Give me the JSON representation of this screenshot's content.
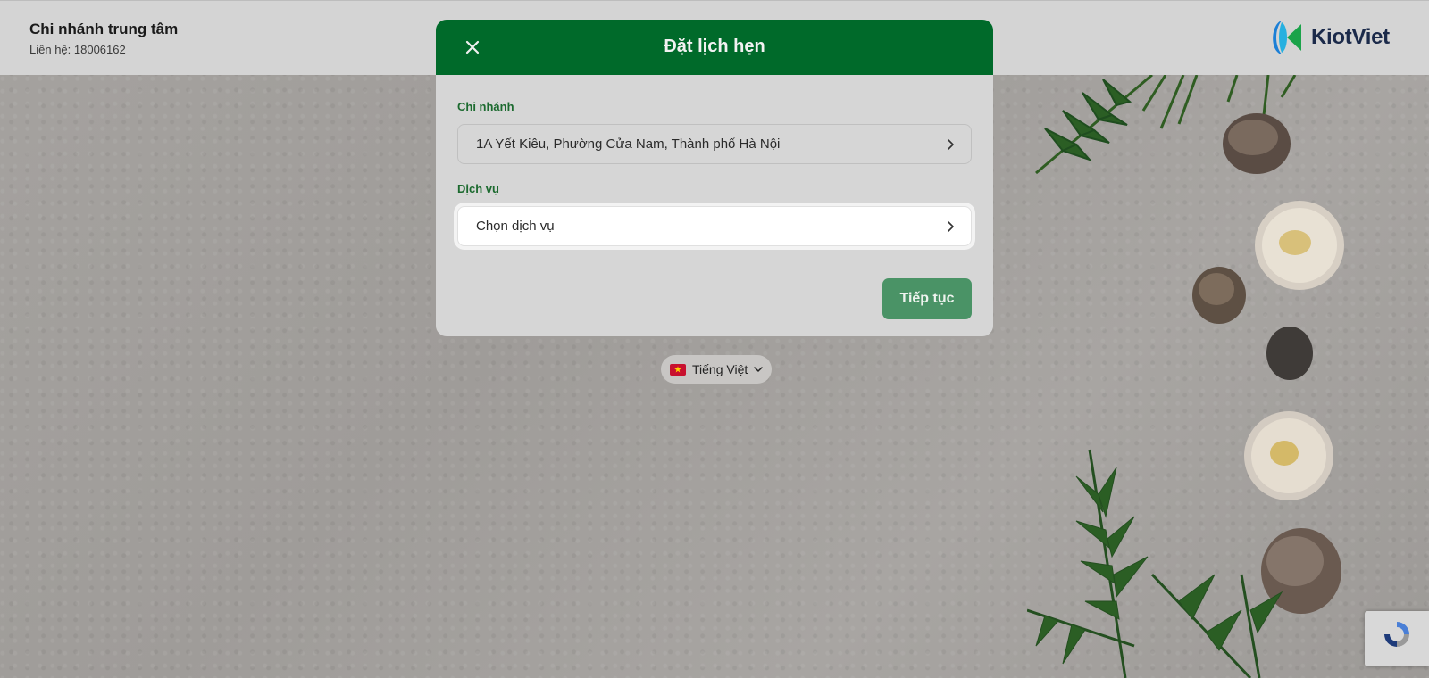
{
  "header": {
    "branch_name": "Chi nhánh trung tâm",
    "contact": "Liên hệ: 18006162",
    "logo_text": "KiotViet"
  },
  "modal": {
    "title": "Đặt lịch hẹn",
    "branch_label": "Chi nhánh",
    "branch_value": "1A Yết Kiêu, Phường Cửa Nam, Thành phố Hà Nội",
    "service_label": "Dịch vụ",
    "service_placeholder": "Chọn dịch vụ",
    "continue_label": "Tiếp tục"
  },
  "language": {
    "selected": "Tiếng Việt"
  },
  "colors": {
    "primary_green": "#006a2a",
    "button_green": "#4a9366",
    "label_green": "#1c6a2f"
  }
}
